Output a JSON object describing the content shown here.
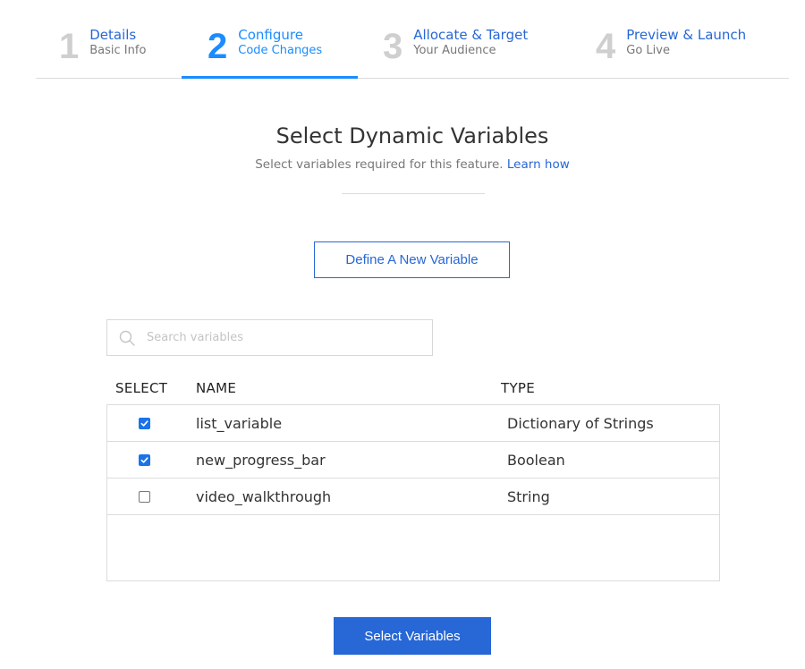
{
  "stepper": {
    "steps": [
      {
        "number": "1",
        "title": "Details",
        "subtitle": "Basic Info",
        "active": false
      },
      {
        "number": "2",
        "title": "Configure",
        "subtitle": "Code Changes",
        "active": true
      },
      {
        "number": "3",
        "title": "Allocate & Target",
        "subtitle": "Your Audience",
        "active": false
      },
      {
        "number": "4",
        "title": "Preview & Launch",
        "subtitle": "Go Live",
        "active": false
      }
    ]
  },
  "header": {
    "title": "Select Dynamic Variables",
    "subtitle": "Select variables required for this feature.",
    "learn_link": "Learn how"
  },
  "define_button": {
    "label": "Define A New Variable"
  },
  "search": {
    "placeholder": "Search variables",
    "value": "",
    "icon": "search-icon"
  },
  "table": {
    "columns": [
      "SELECT",
      "NAME",
      "TYPE"
    ],
    "rows": [
      {
        "selected": true,
        "name": "list_variable",
        "type": "Dictionary of Strings"
      },
      {
        "selected": true,
        "name": "new_progress_bar",
        "type": "Boolean"
      },
      {
        "selected": false,
        "name": "video_walkthrough",
        "type": "String"
      }
    ]
  },
  "primary_button": {
    "label": "Select Variables"
  },
  "colors": {
    "accent": "#1a8cff",
    "link": "#2767d6",
    "button": "#2767d6",
    "checkbox": "#1a73e8",
    "inactive_step_number": "#cfcfcf"
  }
}
